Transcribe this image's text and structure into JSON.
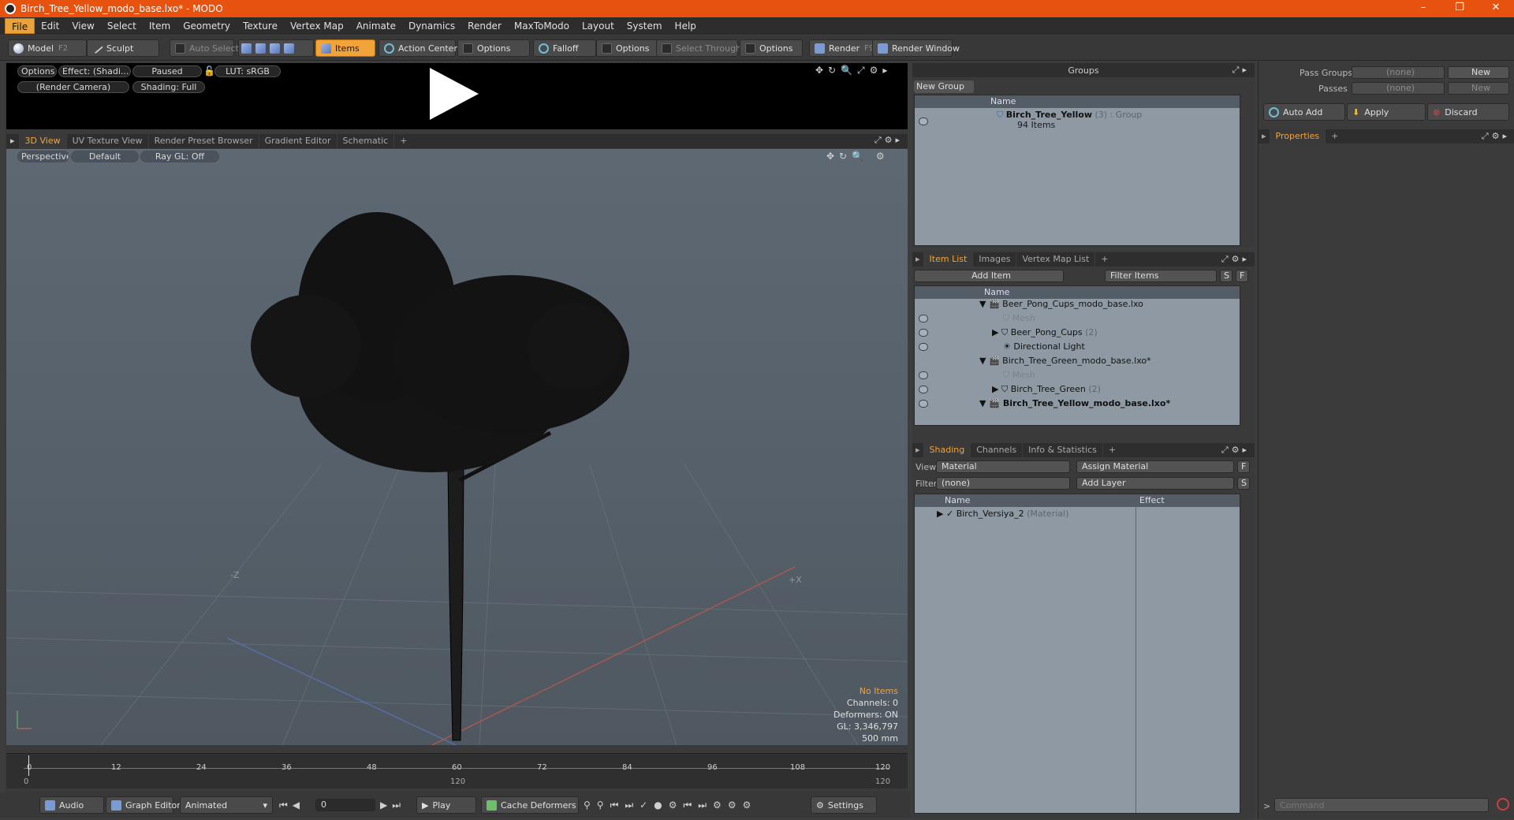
{
  "window": {
    "title": "Birch_Tree_Yellow_modo_base.lxo* - MODO",
    "minimize": "–",
    "restore": "❐",
    "close": "✕"
  },
  "menu": [
    "File",
    "Edit",
    "View",
    "Select",
    "Item",
    "Geometry",
    "Texture",
    "Vertex Map",
    "Animate",
    "Dynamics",
    "Render",
    "MaxToModo",
    "Layout",
    "System",
    "Help"
  ],
  "toolbar": {
    "model": "Model",
    "model_key": "F2",
    "sculpt": "Sculpt",
    "auto_select": "Auto Select",
    "items": "Items",
    "action_center": "Action Center",
    "options1": "Options",
    "falloff": "Falloff",
    "options2": "Options",
    "select_through": "Select Through",
    "options3": "Options",
    "render": "Render",
    "render_key": "F9",
    "render_window": "Render Window"
  },
  "preview": {
    "options": "Options",
    "effect": "Effect: (Shadi...",
    "paused": "Paused",
    "lut": "LUT: sRGB",
    "camera": "(Render Camera)",
    "shading": "Shading: Full"
  },
  "view_tabs": [
    "3D View",
    "UV Texture View",
    "Render Preset Browser",
    "Gradient Editor",
    "Schematic",
    "+"
  ],
  "viewport": {
    "perspective": "Perspective",
    "default": "Default",
    "raygl": "Ray GL: Off",
    "axis_neg_z": "-Z",
    "axis_pos_x": "+X",
    "info": {
      "no_items": "No Items",
      "channels": "Channels: 0",
      "deformers": "Deformers: ON",
      "gl": "GL: 3,346,797",
      "size": "500 mm"
    }
  },
  "timeline": {
    "ticks": [
      "0",
      "12",
      "24",
      "36",
      "48",
      "60",
      "72",
      "84",
      "96",
      "108",
      "120"
    ],
    "start": "0",
    "mid": "120",
    "end": "120"
  },
  "bottombar": {
    "audio": "Audio",
    "graph_editor": "Graph Editor",
    "animated": "Animated",
    "frame": "0",
    "play": "Play",
    "cache": "Cache Deformers",
    "settings": "Settings"
  },
  "groups": {
    "title": "Groups",
    "new_group": "New Group",
    "name_header": "Name",
    "row_name": "Birch_Tree_Yellow",
    "row_count": "(3)",
    "row_type": ": Group",
    "row_items": "94 Items"
  },
  "itemlist": {
    "tabs": [
      "Item List",
      "Images",
      "Vertex Map List",
      "+"
    ],
    "add_item": "Add Item",
    "filter_items": "Filter Items",
    "s": "S",
    "f": "F",
    "name_header": "Name",
    "rows": [
      {
        "text": "Beer_Pong_Cups_modo_base.lxo",
        "extra": ""
      },
      {
        "text": "Mesh",
        "extra": ""
      },
      {
        "text": "Beer_Pong_Cups",
        "extra": "(2)"
      },
      {
        "text": "Directional Light",
        "extra": ""
      },
      {
        "text": "Birch_Tree_Green_modo_base.lxo*",
        "extra": ""
      },
      {
        "text": "Mesh",
        "extra": ""
      },
      {
        "text": "Birch_Tree_Green",
        "extra": "(2)"
      },
      {
        "text": "Birch_Tree_Yellow_modo_base.lxo*",
        "extra": ""
      }
    ]
  },
  "shading": {
    "tabs": [
      "Shading",
      "Channels",
      "Info & Statistics",
      "+"
    ],
    "view_label": "View",
    "view_value": "Material",
    "assign_material": "Assign Material",
    "f": "F",
    "filter_label": "Filter",
    "filter_value": "(none)",
    "add_layer": "Add Layer",
    "s": "S",
    "name_header": "Name",
    "effect_header": "Effect",
    "row_name": "Birch_Versiya_2",
    "row_type": "(Material)"
  },
  "properties": {
    "pass_groups_label": "Pass Groups",
    "pass_groups_value": "(none)",
    "new1": "New",
    "passes_label": "Passes",
    "passes_value": "(none)",
    "new2": "New",
    "auto_add": "Auto Add",
    "apply": "Apply",
    "discard": "Discard",
    "tab": "Properties",
    "plus": "+",
    "command_placeholder": "Command"
  },
  "colors": {
    "accent": "#f2a33a",
    "titlebar": "#e8520f",
    "panel": "#8e99a3"
  }
}
